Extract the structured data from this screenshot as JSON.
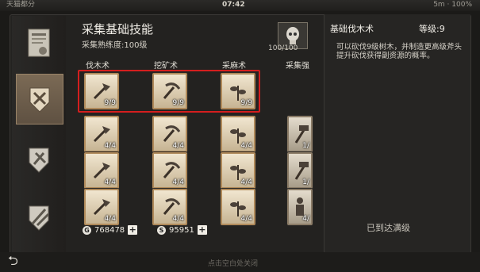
{
  "statusbar": {
    "left": "天猫都分",
    "time": "07:42",
    "right": "5m · 100%"
  },
  "header": {
    "title": "采集基础技能",
    "proficiency": "采集熟练度:100级",
    "avatar_count": "100/100"
  },
  "columns": [
    "伐木术",
    "挖矿术",
    "采麻术",
    "采集强"
  ],
  "rows": [
    [
      "9/9",
      "9/9",
      "9/9"
    ],
    [
      "4/4",
      "4/4",
      "4/4",
      "1/"
    ],
    [
      "4/4",
      "4/4",
      "4/4",
      "1/"
    ],
    [
      "4/4",
      "4/4",
      "4/4",
      "4/"
    ]
  ],
  "currency": {
    "gold": "768478",
    "silver": "95951",
    "gold_icon": "G",
    "silver_icon": "S"
  },
  "detail": {
    "name": "基础伐木术",
    "level": "等级:9",
    "description": "可以砍伐9级树木，并制造更高级斧头提升砍伐获得副资源的概率。",
    "status": "已到达满级"
  },
  "bottom": {
    "hint": "点击空白处关闭"
  },
  "icons": {
    "back": "back-arrow-icon",
    "categories": [
      "certificate-icon",
      "gather-skill-icon",
      "craft-skill-icon",
      "weapon-skill-icon"
    ]
  }
}
